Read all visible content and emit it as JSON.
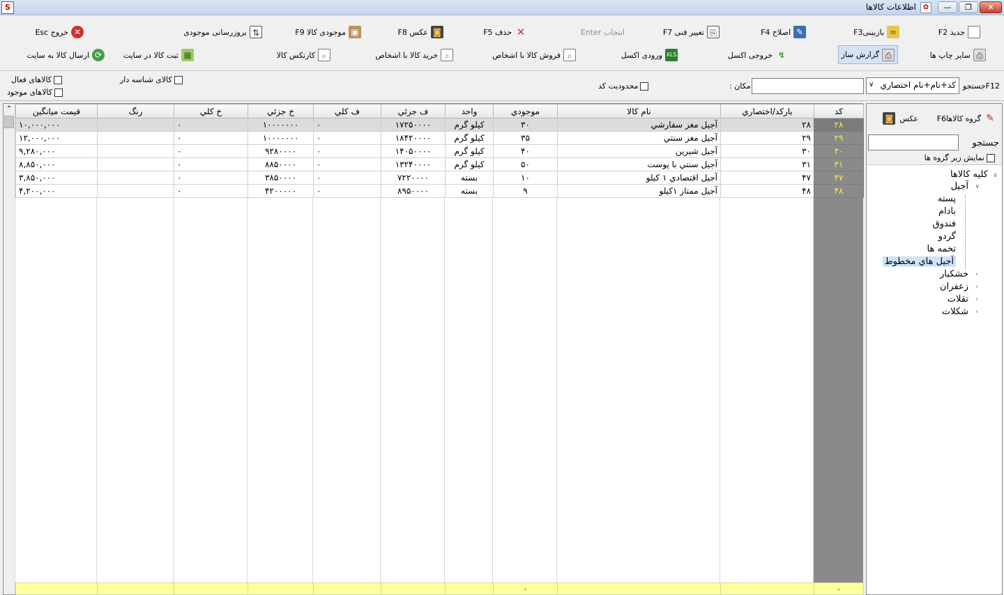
{
  "window": {
    "title": "اطلاعات کالاها",
    "controls": {
      "minimize": "—",
      "restore": "❐",
      "close": "✕"
    }
  },
  "toolbar": {
    "row1": [
      {
        "id": "new",
        "label": "جدید F2",
        "icon": "new-document-icon"
      },
      {
        "id": "review",
        "label": "بازبینیF3",
        "icon": "glasses-icon"
      },
      {
        "id": "edit",
        "label": "اصلاح F4",
        "icon": "pencil-icon"
      },
      {
        "id": "change-tech",
        "label": "تغییر فنی F7",
        "icon": "tech-change-icon"
      },
      {
        "id": "select",
        "label": "انتخاب Enter",
        "icon": "",
        "disabled": true
      },
      {
        "id": "delete",
        "label": "حذف F5",
        "icon": "delete-x-icon"
      },
      {
        "id": "photo",
        "label": "عکس F8",
        "icon": "photo-icon"
      },
      {
        "id": "stock",
        "label": "موجودی کالا F9",
        "icon": "box-icon"
      },
      {
        "id": "update-stock",
        "label": "بروزرسانی موجودی",
        "icon": "update-icon"
      },
      {
        "id": "exit",
        "label": "خروج Esc",
        "icon": "exit-icon"
      }
    ],
    "row2": [
      {
        "id": "other-print",
        "label": "سایر چاپ ها",
        "icon": "printer-icon"
      },
      {
        "id": "report-builder",
        "label": "گزارش ساز",
        "icon": "report-printer-icon",
        "active": true
      },
      {
        "id": "excel-out",
        "label": "خروجی اکسل",
        "icon": "excel-export-icon"
      },
      {
        "id": "excel-in",
        "label": "ورودی اکسل",
        "icon": "excel-import-icon"
      },
      {
        "id": "sell-person",
        "label": "فروش کالا با اشخاص",
        "icon": "magnifier-icon"
      },
      {
        "id": "buy-person",
        "label": "خرید کالا با اشخاص",
        "icon": "magnifier-icon"
      },
      {
        "id": "cardex",
        "label": "کارتکس کالا",
        "icon": "magnifier-icon"
      },
      {
        "id": "register-site",
        "label": "ثبت کالا در سایت",
        "icon": "web-register-icon"
      },
      {
        "id": "send-site",
        "label": "ارسال کالا به سایت",
        "icon": "sync-icon"
      }
    ]
  },
  "filters": {
    "search_label": "F12جستجو",
    "search_mode": "کد+نام+نام اختصاري",
    "place_label": "مکان :",
    "place_value": "",
    "code_limit": "محدودیت کد",
    "serial_goods": "کالای شناسه دار",
    "active_goods": "کالاهای فعال",
    "available_goods": "کالاهای موجود"
  },
  "grid": {
    "columns": [
      "کد",
      "بارکد/اختصاري",
      "نام کالا",
      "موجودي",
      "واحد",
      "ف جزئي",
      "ف کلي",
      "خ جزئي",
      "خ کلي",
      "رنگ",
      "قيمت ميانگين"
    ],
    "rows": [
      {
        "code": "۲۸",
        "barcode": "۲۸",
        "name": "آجیل مغز سفارشي",
        "stock": "۳۰",
        "unit": "کیلو گرم",
        "sell_part": "۱۷۲۵۰۰۰۰",
        "sell_total": "۰",
        "buy_part": "۱۰۰۰۰۰۰۰",
        "buy_total": "۰",
        "color": "",
        "avg_price": "۱۰,۰۰۰,۰۰۰",
        "selected": true
      },
      {
        "code": "۲۹",
        "barcode": "۲۹",
        "name": "آجیل مغز سنتي",
        "stock": "۳۵",
        "unit": "کیلو گرم",
        "sell_part": "۱۸۴۲۰۰۰۰",
        "sell_total": "۰",
        "buy_part": "۱۰۰۰۰۰۰۰",
        "buy_total": "۰",
        "color": "",
        "avg_price": "۱۲,۰۰۰,۰۰۰"
      },
      {
        "code": "۳۰",
        "barcode": "۳۰",
        "name": "آجیل شیرین",
        "stock": "۴۰",
        "unit": "کیلو گرم",
        "sell_part": "۱۴۰۵۰۰۰۰",
        "sell_total": "۰",
        "buy_part": "۹۲۸۰۰۰۰",
        "buy_total": "۰",
        "color": "",
        "avg_price": "۹,۲۸۰,۰۰۰"
      },
      {
        "code": "۳۱",
        "barcode": "۳۱",
        "name": "آجیل سنتي با پوست",
        "stock": "۵۰",
        "unit": "کیلو گرم",
        "sell_part": "۱۳۲۴۰۰۰۰",
        "sell_total": "۰",
        "buy_part": "۸۸۵۰۰۰۰",
        "buy_total": "۰",
        "color": "",
        "avg_price": "۸,۸۵۰,۰۰۰"
      },
      {
        "code": "۴۷",
        "barcode": "۴۷",
        "name": "آجیل اقتصادي ۱ کیلو",
        "stock": "۱۰",
        "unit": "بسته",
        "sell_part": "۷۲۲۰۰۰۰",
        "sell_total": "۰",
        "buy_part": "۳۸۵۰۰۰۰",
        "buy_total": "۰",
        "color": "",
        "avg_price": "۳,۸۵۰,۰۰۰"
      },
      {
        "code": "۴۸",
        "barcode": "۴۸",
        "name": "آجیل ممتاز ۱کیلو",
        "stock": "۹",
        "unit": "بسته",
        "sell_part": "۸۹۵۰۰۰۰",
        "sell_total": "۰",
        "buy_part": "۴۲۰۰۰۰۰",
        "buy_total": "۰",
        "color": "",
        "avg_price": "۴,۲۰۰,۰۰۰"
      }
    ],
    "footer": {
      "code": "۰",
      "stock": "۰"
    }
  },
  "sidepanel": {
    "group_button": "گروه کالاهاF6",
    "photo_button": "عکس",
    "search_label": "جستجو",
    "search_value": "",
    "show_subgroups": "نمایش زیر گروه ها",
    "tree": {
      "root": "کلیه کالاها",
      "items": [
        {
          "label": "آجیل",
          "level": 1,
          "expanded": true
        },
        {
          "label": "پسته",
          "level": 2
        },
        {
          "label": "بادام",
          "level": 2
        },
        {
          "label": "فندوق",
          "level": 2
        },
        {
          "label": "گردو",
          "level": 2
        },
        {
          "label": "تخمه ها",
          "level": 2
        },
        {
          "label": "آجیل هاي مخطوط",
          "level": 2,
          "selected": true
        },
        {
          "label": "خشکبار",
          "level": 1
        },
        {
          "label": "زعفران",
          "level": 1
        },
        {
          "label": "تقلات",
          "level": 1
        },
        {
          "label": "شکلات",
          "level": 1
        }
      ]
    }
  },
  "colors": {
    "code_bg": "#8a8a8a",
    "code_fg": "#ffeb3b",
    "footer_bg": "#ffff9e",
    "select_bg": "#dcdcdc",
    "tree_sel": "#cde3f7"
  }
}
